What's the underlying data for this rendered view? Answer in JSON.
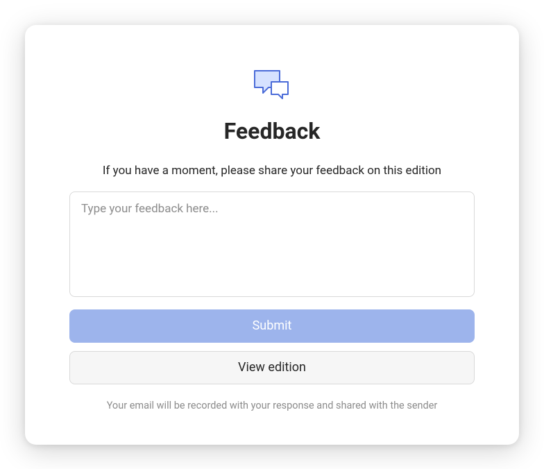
{
  "title": "Feedback",
  "subtitle": "If you have a moment, please share your feedback on this edition",
  "textarea": {
    "placeholder": "Type your feedback here...",
    "value": ""
  },
  "buttons": {
    "submit": "Submit",
    "view_edition": "View edition"
  },
  "footer_note": "Your email will be recorded with your response and shared with the sender",
  "colors": {
    "primary": "#9db4ec",
    "icon_fill": "#d6e2ff",
    "icon_stroke": "#4a6bd8"
  }
}
